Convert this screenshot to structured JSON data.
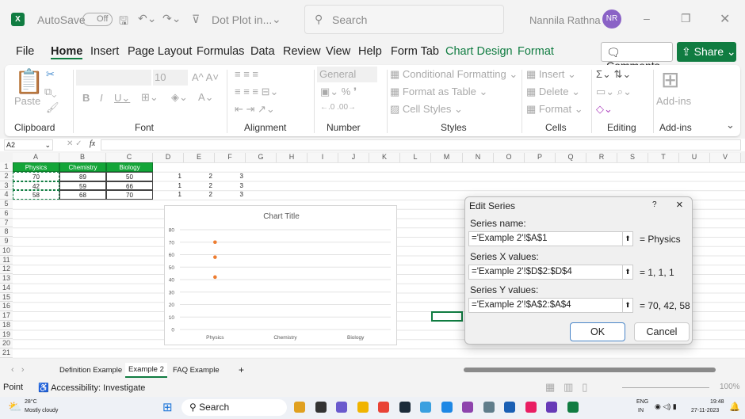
{
  "titlebar": {
    "autosave": "AutoSave",
    "toggle": "Off",
    "filename": "Dot Plot in...",
    "search": "Search",
    "user": "Nannila Rathna",
    "initials": "NR"
  },
  "menu": [
    "File",
    "Home",
    "Insert",
    "Page Layout",
    "Formulas",
    "Data",
    "Review",
    "View",
    "Help",
    "Form Tab",
    "Chart Design",
    "Format"
  ],
  "comments": "Comments",
  "share": "Share",
  "ribbon": {
    "groups": [
      "Clipboard",
      "Font",
      "Alignment",
      "Number",
      "Styles",
      "Cells",
      "Editing",
      "Add-ins"
    ],
    "paste": "Paste",
    "font_size": "10",
    "number_format": "General",
    "conditional": "Conditional Formatting",
    "format_table": "Format as Table",
    "cell_styles": "Cell Styles",
    "insert": "Insert",
    "delete": "Delete",
    "format": "Format",
    "addins": "Add-ins"
  },
  "formula_bar": {
    "name_box": "A2",
    "fx": "fx",
    "value": ""
  },
  "columns": [
    "A",
    "B",
    "C",
    "D",
    "E",
    "F",
    "G",
    "H",
    "I",
    "J",
    "K",
    "L",
    "M",
    "N",
    "O",
    "P",
    "Q",
    "R",
    "S",
    "T",
    "U",
    "V"
  ],
  "rows": [
    "1",
    "2",
    "3",
    "4",
    "5",
    "6",
    "7",
    "8",
    "9",
    "10",
    "11",
    "12",
    "13",
    "14",
    "15",
    "16",
    "17",
    "18",
    "19",
    "20",
    "21"
  ],
  "table": {
    "headers": [
      "Physics",
      "Chemistry",
      "Biology"
    ],
    "rows": [
      [
        "70",
        "89",
        "50"
      ],
      [
        "42",
        "59",
        "66"
      ],
      [
        "58",
        "68",
        "70"
      ]
    ]
  },
  "xvals": [
    [
      "1",
      "2",
      "3"
    ],
    [
      "1",
      "2",
      "3"
    ],
    [
      "1",
      "2",
      "3"
    ]
  ],
  "chart_data": {
    "type": "scatter",
    "title": "Chart Title",
    "categories": [
      "Physics",
      "Chemistry",
      "Biology"
    ],
    "ylim": [
      0,
      80
    ],
    "yticks": [
      "0",
      "10",
      "20",
      "30",
      "40",
      "50",
      "60",
      "70",
      "80"
    ],
    "grid": true,
    "color": "#ed7d31",
    "series": [
      {
        "name": "Physics",
        "x": [
          1,
          1,
          1
        ],
        "y": [
          70,
          42,
          58
        ]
      }
    ]
  },
  "dialog": {
    "title": "Edit Series",
    "help": "?",
    "close": "×",
    "name_label": "Series name:",
    "name_value": "='Example 2'!$A$1",
    "name_result": "= Physics",
    "x_label": "Series X values:",
    "x_value": "='Example 2'!$D$2:$D$4",
    "x_result": "= 1, 1, 1",
    "y_label": "Series Y values:",
    "y_value": "='Example 2'!$A$2:$A$4",
    "y_result": "= 70, 42, 58",
    "ok": "OK",
    "cancel": "Cancel"
  },
  "sheets": [
    "Definition Example",
    "Example 2",
    "FAQ Example"
  ],
  "add_sheet": "+",
  "status": {
    "mode": "Point",
    "accessibility": "Accessibility: Investigate",
    "zoom": "100%"
  },
  "taskbar": {
    "temp": "28°C",
    "weather": "Mostly cloudy",
    "search": "Search",
    "lang1": "ENG",
    "lang2": "IN",
    "time": "19:48",
    "date": "27-11-2023"
  },
  "colors": {
    "accent": "#107c41",
    "header_fill": "#13a538",
    "marker": "#ed7d31"
  }
}
